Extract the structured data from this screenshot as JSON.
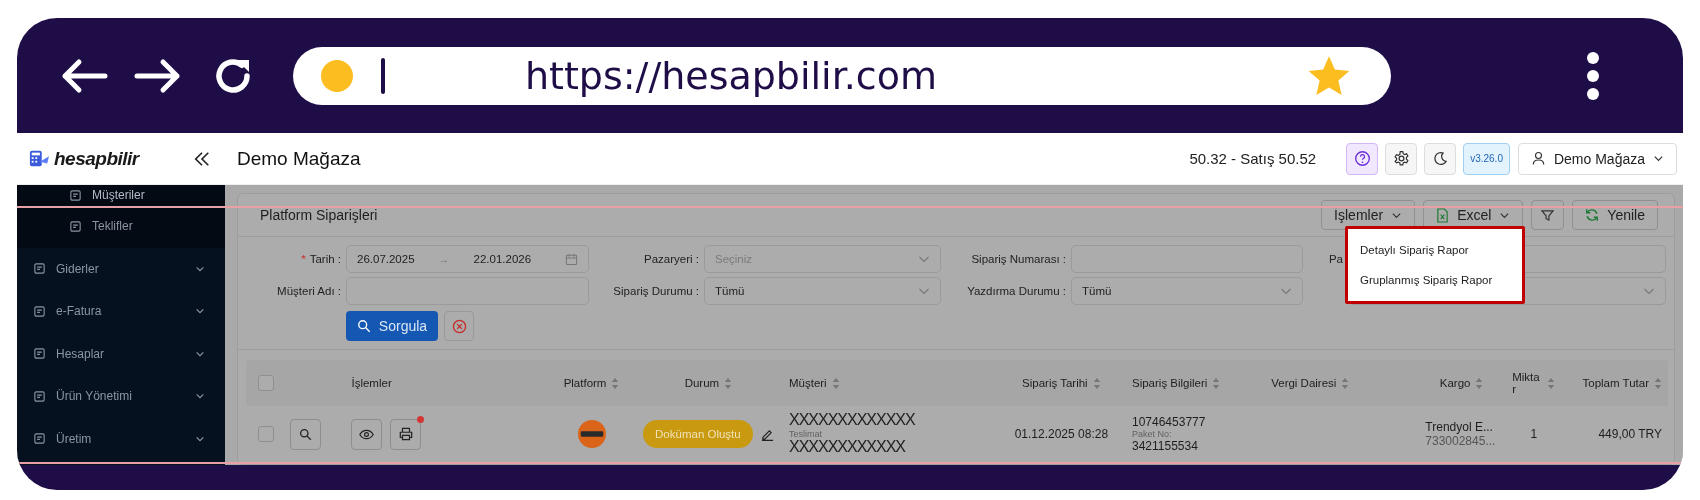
{
  "browser": {
    "url": "https://hesapbilir.com"
  },
  "header": {
    "logo_text": "hesapbilir",
    "store_title": "Demo Mağaza",
    "rate": "50.32 - Satış 50.52",
    "version": "v3.26.0",
    "user": "Demo Mağaza"
  },
  "sidebar": {
    "items": [
      {
        "label": "Müşteriler",
        "kind": "sub"
      },
      {
        "label": "Teklifler",
        "kind": "sub"
      },
      {
        "label": "Giderler",
        "kind": "group"
      },
      {
        "label": "e-Fatura",
        "kind": "group"
      },
      {
        "label": "Hesaplar",
        "kind": "group"
      },
      {
        "label": "Ürün Yönetimi",
        "kind": "group"
      },
      {
        "label": "Üretim",
        "kind": "group"
      }
    ]
  },
  "page": {
    "title": "Platform Siparişleri",
    "toolbar": [
      {
        "kind": "dropdown",
        "label": "İşlemler"
      },
      {
        "kind": "excel",
        "label": "Excel"
      },
      {
        "kind": "filter"
      },
      {
        "kind": "refresh",
        "label": "Yenile"
      }
    ],
    "menu": {
      "items": [
        "Detaylı Sipariş Rapor",
        "Gruplanmış Sipariş Rapor"
      ]
    },
    "filters": [
      {
        "kind": "date",
        "required_mark": "*",
        "label": "Tarih :",
        "from": "26.07.2025",
        "separator": "→",
        "to": "22.01.2026"
      },
      {
        "kind": "select",
        "label": "Pazaryeri :",
        "placeholder": "Seçiniz"
      },
      {
        "kind": "input",
        "label": "Sipariş Numarası :"
      },
      {
        "kind": "input",
        "label": "Pa"
      },
      {
        "kind": "input",
        "label": "Müşteri Adı :"
      },
      {
        "kind": "select",
        "label": "Sipariş Durumu :",
        "value": "Tümü"
      },
      {
        "kind": "select",
        "label": "Yazdırma Durumu :",
        "value": "Tümü"
      },
      {
        "kind": "select"
      }
    ],
    "search_button": "Sorgula"
  },
  "table": {
    "select_all": {
      "checked": false
    },
    "columns": [
      {
        "label": "İşlemler",
        "sortable": false
      },
      {
        "label": "Platform",
        "sortable": true
      },
      {
        "label": "Durum",
        "sortable": true
      },
      {
        "label": "Müşteri",
        "sortable": true
      },
      {
        "label": "Sipariş Tarihi",
        "sortable": true
      },
      {
        "label": "Sipariş Bilgileri",
        "sortable": true
      },
      {
        "label": "Vergi Dairesi",
        "sortable": true
      },
      {
        "label": "Kargo",
        "sortable": true
      },
      {
        "label": "Miktar",
        "sortable": true
      },
      {
        "label": "Toplam Tutar",
        "sortable": true
      }
    ],
    "rows": [
      {
        "checked": false,
        "print_badge": true,
        "status": "Doküman Oluştu",
        "customer": "XXXXXXXXXXXXX",
        "customer_note": "Teslimat",
        "delivery_name": "XXXXXXXXXXXX",
        "date": "01.12.2025 08:28",
        "order_no": "10746453777",
        "package_label": "Paket No:",
        "package_no": "3421155534",
        "cargo": "Trendyol E...",
        "tracking": "733002845...",
        "quantity": "1",
        "total": "449,00 TRY"
      }
    ]
  }
}
